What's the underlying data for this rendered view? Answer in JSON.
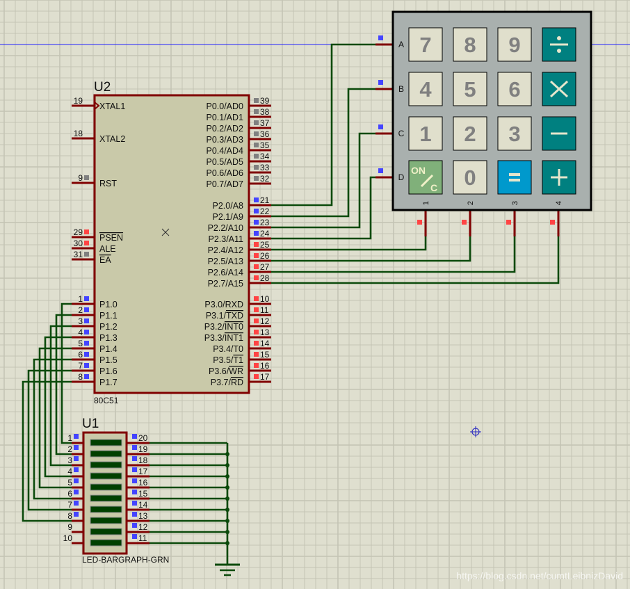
{
  "u2": {
    "ref": "U2",
    "part": "80C51",
    "left_pins": [
      {
        "num": "19",
        "name": "XTAL1",
        "state": "none",
        "clock": true
      },
      {
        "num": "18",
        "name": "XTAL2",
        "state": "none"
      },
      {
        "num": "9",
        "name": "RST",
        "state": "gray"
      },
      {
        "num": "29",
        "name": "",
        "over": "PSEN",
        "state": "red"
      },
      {
        "num": "30",
        "name": "ALE",
        "state": "red"
      },
      {
        "num": "31",
        "name": "",
        "over": "EA",
        "state": "gray"
      },
      {
        "num": "1",
        "name": "P1.0",
        "state": "blue"
      },
      {
        "num": "2",
        "name": "P1.1",
        "state": "blue"
      },
      {
        "num": "3",
        "name": "P1.2",
        "state": "blue"
      },
      {
        "num": "4",
        "name": "P1.3",
        "state": "blue"
      },
      {
        "num": "5",
        "name": "P1.4",
        "state": "blue"
      },
      {
        "num": "6",
        "name": "P1.5",
        "state": "blue"
      },
      {
        "num": "7",
        "name": "P1.6",
        "state": "blue"
      },
      {
        "num": "8",
        "name": "P1.7",
        "state": "blue"
      }
    ],
    "right_pins": [
      {
        "num": "39",
        "name": "P0.0/AD0",
        "state": "gray"
      },
      {
        "num": "38",
        "name": "P0.1/AD1",
        "state": "gray"
      },
      {
        "num": "37",
        "name": "P0.2/AD2",
        "state": "gray"
      },
      {
        "num": "36",
        "name": "P0.3/AD3",
        "state": "gray"
      },
      {
        "num": "35",
        "name": "P0.4/AD4",
        "state": "gray"
      },
      {
        "num": "34",
        "name": "P0.5/AD5",
        "state": "gray"
      },
      {
        "num": "33",
        "name": "P0.6/AD6",
        "state": "gray"
      },
      {
        "num": "32",
        "name": "P0.7/AD7",
        "state": "gray"
      },
      {
        "num": "21",
        "name": "P2.0/A8",
        "state": "blue"
      },
      {
        "num": "22",
        "name": "P2.1/A9",
        "state": "blue"
      },
      {
        "num": "23",
        "name": "P2.2/A10",
        "state": "blue"
      },
      {
        "num": "24",
        "name": "P2.3/A11",
        "state": "blue"
      },
      {
        "num": "25",
        "name": "P2.4/A12",
        "state": "red"
      },
      {
        "num": "26",
        "name": "P2.5/A13",
        "state": "red"
      },
      {
        "num": "27",
        "name": "P2.6/A14",
        "state": "red"
      },
      {
        "num": "28",
        "name": "P2.7/A15",
        "state": "red"
      },
      {
        "num": "10",
        "name": "P3.0/RXD",
        "state": "red"
      },
      {
        "num": "11",
        "name": "P3.1/",
        "over": "TXD",
        "state": "red"
      },
      {
        "num": "12",
        "name": "P3.2/",
        "over": "INT0",
        "state": "red"
      },
      {
        "num": "13",
        "name": "P3.3/",
        "over": "INT1",
        "state": "red"
      },
      {
        "num": "14",
        "name": "P3.4/T0",
        "state": "red"
      },
      {
        "num": "15",
        "name": "P3.5/",
        "over": "T1",
        "state": "red"
      },
      {
        "num": "16",
        "name": "P3.6/",
        "over": "WR",
        "state": "red"
      },
      {
        "num": "17",
        "name": "P3.7/",
        "over": "RD",
        "state": "red"
      }
    ]
  },
  "keypad": {
    "rows": [
      {
        "label": "A",
        "state": "blue"
      },
      {
        "label": "B",
        "state": "blue"
      },
      {
        "label": "C",
        "state": "blue"
      },
      {
        "label": "D",
        "state": "blue"
      }
    ],
    "cols": [
      {
        "label": "1",
        "state": "red"
      },
      {
        "label": "2",
        "state": "red"
      },
      {
        "label": "3",
        "state": "red"
      },
      {
        "label": "4",
        "state": "red"
      }
    ],
    "keys": [
      [
        {
          "label": "7",
          "kind": "digit"
        },
        {
          "label": "8",
          "kind": "digit"
        },
        {
          "label": "9",
          "kind": "digit"
        },
        {
          "label": "÷",
          "kind": "op",
          "icon": "divide-icon"
        }
      ],
      [
        {
          "label": "4",
          "kind": "digit"
        },
        {
          "label": "5",
          "kind": "digit"
        },
        {
          "label": "6",
          "kind": "digit"
        },
        {
          "label": "×",
          "kind": "op",
          "icon": "multiply-icon"
        }
      ],
      [
        {
          "label": "1",
          "kind": "digit"
        },
        {
          "label": "2",
          "kind": "digit"
        },
        {
          "label": "3",
          "kind": "digit"
        },
        {
          "label": "−",
          "kind": "op",
          "icon": "minus-icon"
        }
      ],
      [
        {
          "label": "ON/C",
          "kind": "clear",
          "icon": "on-clear-icon"
        },
        {
          "label": "0",
          "kind": "digit"
        },
        {
          "label": "=",
          "kind": "equals",
          "icon": "equals-icon"
        },
        {
          "label": "+",
          "kind": "op",
          "icon": "plus-icon"
        }
      ]
    ]
  },
  "u1": {
    "ref": "U1",
    "part": "LED-BARGRAPH-GRN",
    "left_pins": [
      {
        "num": "1",
        "state": "blue"
      },
      {
        "num": "2",
        "state": "blue"
      },
      {
        "num": "3",
        "state": "blue"
      },
      {
        "num": "4",
        "state": "blue"
      },
      {
        "num": "5",
        "state": "blue"
      },
      {
        "num": "6",
        "state": "blue"
      },
      {
        "num": "7",
        "state": "blue"
      },
      {
        "num": "8",
        "state": "blue"
      },
      {
        "num": "9",
        "state": "none"
      },
      {
        "num": "10",
        "state": "none"
      }
    ],
    "right_pins": [
      {
        "num": "20",
        "state": "blue"
      },
      {
        "num": "19",
        "state": "blue"
      },
      {
        "num": "18",
        "state": "blue"
      },
      {
        "num": "17",
        "state": "blue"
      },
      {
        "num": "16",
        "state": "blue"
      },
      {
        "num": "15",
        "state": "blue"
      },
      {
        "num": "14",
        "state": "blue"
      },
      {
        "num": "13",
        "state": "blue"
      },
      {
        "num": "12",
        "state": "blue"
      },
      {
        "num": "11",
        "state": "blue"
      }
    ],
    "segments_lit": 0
  },
  "colors": {
    "background": "#dfdfcf",
    "grid": "#c4c4b4",
    "pin": "#800000",
    "wire": "#0b4a0b",
    "chip_fill": "#c9c9a9",
    "keypad_fill": "#a9b0ae",
    "blue": "#4444ff",
    "red": "#ff4444",
    "gray": "#808080"
  },
  "watermark": "https://blog.csdn.net/cumtLeibnizDavid"
}
